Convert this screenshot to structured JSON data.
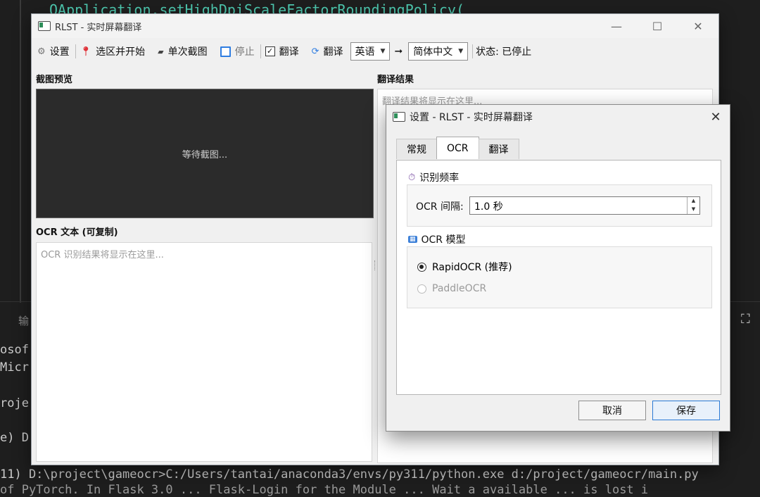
{
  "background": {
    "editor_line": "QApplication.setHighDpiScaleFactorRoundingPolicy(",
    "panel_tab": "输",
    "terminal_lines": [
      "osof",
      "Micr",
      "roje",
      "e) D",
      "11) D:\\project\\gameocr>C:/Users/tantai/anaconda3/envs/py311/python.exe d:/project/gameocr/main.py",
      "of PyTorch. In Flask 3.0 ... Flask-Login for the Module ... Wait a available ... is lost i"
    ]
  },
  "main_window": {
    "title": "RLST - 实时屏幕翻译",
    "controls": {
      "minimize": "—",
      "maximize": "☐",
      "close": "✕"
    },
    "toolbar": {
      "settings": "设置",
      "select_start": "选区并开始",
      "single_capture": "单次截图",
      "stop": "停止",
      "translate_check": "翻译",
      "translate_btn": "翻译",
      "source_lang": "英语",
      "arrow": "➞",
      "target_lang": "简体中文",
      "status": "状态: 已停止"
    },
    "preview_label": "截图预览",
    "preview_placeholder": "等待截图...",
    "ocr_label": "OCR 文本 (可复制)",
    "ocr_placeholder": "OCR 识别结果将显示在这里...",
    "translation_label": "翻译结果",
    "translation_placeholder": "翻译结果将显示在这里..."
  },
  "dialog": {
    "title": "设置 - RLST - 实时屏幕翻译",
    "close": "✕",
    "tabs": [
      "常规",
      "OCR",
      "翻译"
    ],
    "active_tab": "OCR",
    "freq_group": "识别频率",
    "interval_label": "OCR 间隔:",
    "interval_value": "1.0 秒",
    "model_group": "OCR 模型",
    "models": [
      {
        "label": "RapidOCR (推荐)",
        "checked": true,
        "enabled": true
      },
      {
        "label": "PaddleOCR",
        "checked": false,
        "enabled": false
      }
    ],
    "cancel": "取消",
    "save": "保存"
  },
  "colors": {
    "accent": "#2a7ad6",
    "preview_bg": "#2b2b2b",
    "editor_teal": "#4ec9b0"
  }
}
